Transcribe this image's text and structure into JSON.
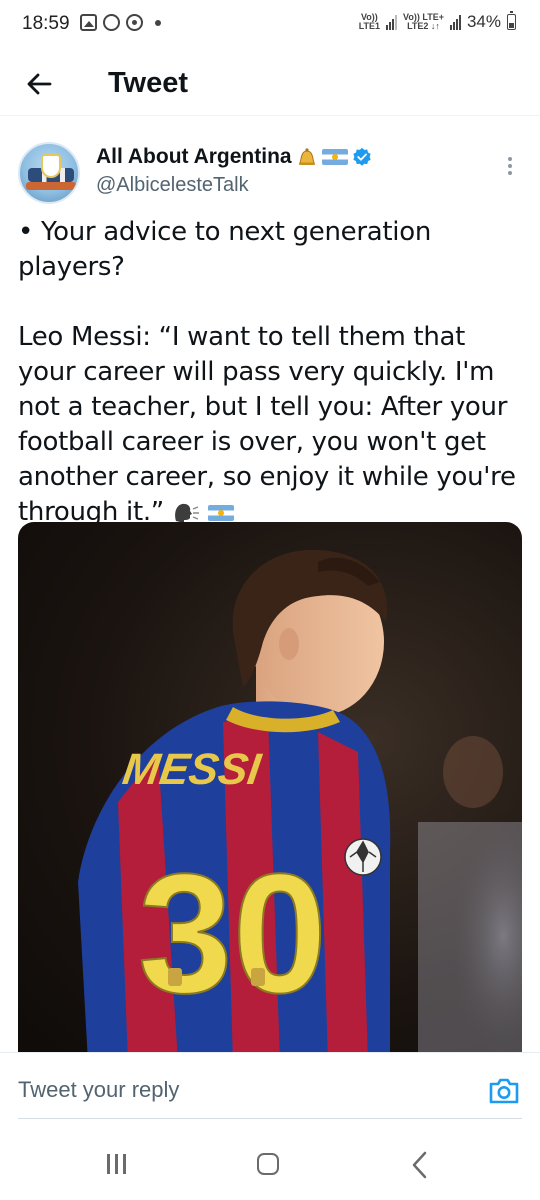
{
  "status_bar": {
    "time": "18:59",
    "net1_top": "Vo))",
    "net1_bottom": "LTE1",
    "net2_top": "Vo)) LTE+",
    "net2_bottom": "LTE2 ↓↑",
    "battery_percent": "34%",
    "battery_level": 0.34
  },
  "header": {
    "title": "Tweet",
    "back_icon": "arrow-left-icon"
  },
  "tweet": {
    "author_name": "All About Argentina",
    "author_handle": "@AlbicelesteTalk",
    "name_emojis": [
      "bell-icon",
      "argentina-flag-icon",
      "verified-badge-icon"
    ],
    "text_line1": "• Your advice to next generation players?",
    "text_body": "Leo Messi: “I want to tell them that your career will pass very quickly. I'm not a teacher, but I tell you: After your football career is over, you won't get another career, so enjoy it while you're through it.”",
    "text_emojis": [
      "speaking-head-icon",
      "argentina-flag-icon"
    ],
    "media": {
      "jersey_name": "MESSI",
      "jersey_number": "30"
    }
  },
  "reply": {
    "placeholder": "Tweet your reply",
    "camera_icon": "camera-icon"
  },
  "navbar": {
    "items": [
      "recents-icon",
      "home-icon",
      "back-icon"
    ]
  },
  "colors": {
    "accent": "#1d9bf0",
    "text": "#0f1419",
    "secondary_text": "#536471"
  }
}
